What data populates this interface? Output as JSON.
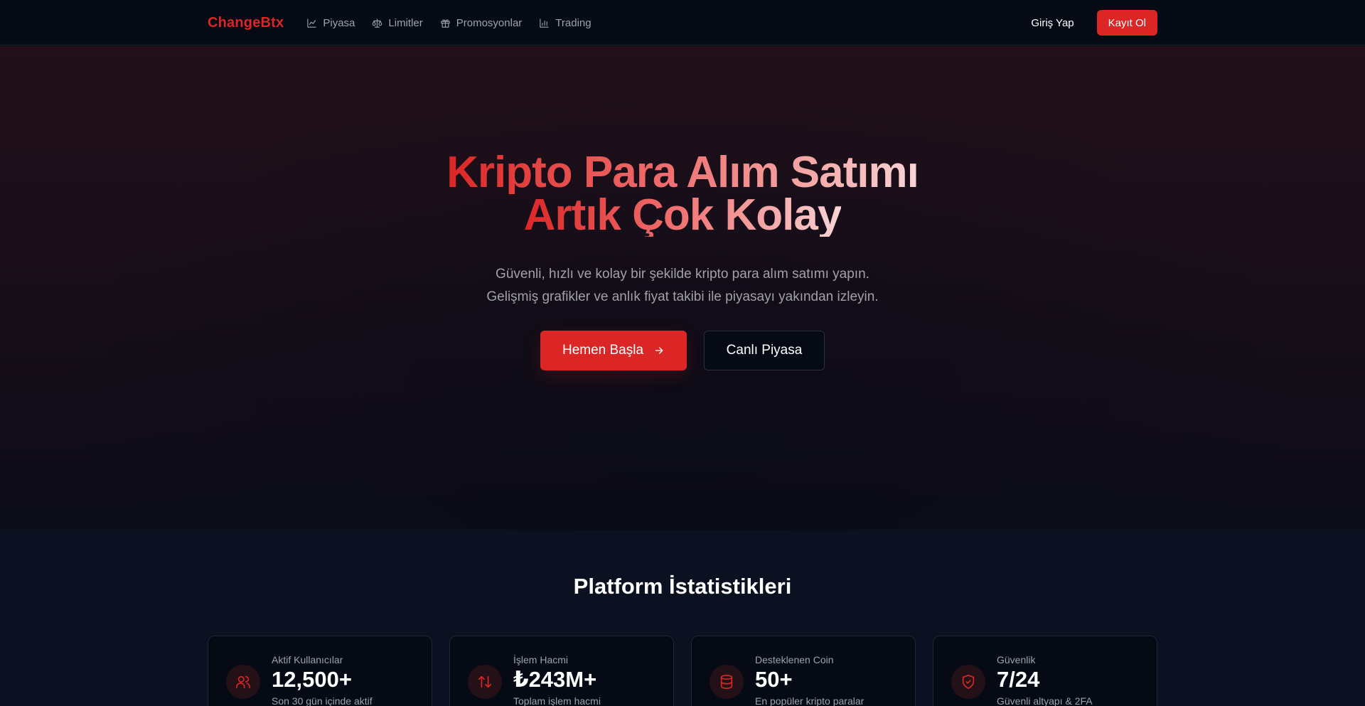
{
  "nav": {
    "brand": "ChangeBtx",
    "links": [
      {
        "label": "Piyasa",
        "icon": "line-chart-icon"
      },
      {
        "label": "Limitler",
        "icon": "scale-icon"
      },
      {
        "label": "Promosyonlar",
        "icon": "gift-icon"
      },
      {
        "label": "Trading",
        "icon": "bar-chart-icon"
      }
    ],
    "login_label": "Giriş Yap",
    "signup_label": "Kayıt Ol"
  },
  "hero": {
    "title_line1": "Kripto Para Alım Satımı",
    "title_line2": "Artık Çok Kolay",
    "subtitle_line1": "Güvenli, hızlı ve kolay bir şekilde kripto para alım satımı yapın.",
    "subtitle_line2": "Gelişmiş grafikler ve anlık fiyat takibi ile piyasayı yakından izleyin.",
    "primary_button": "Hemen Başla",
    "secondary_button": "Canlı Piyasa"
  },
  "stats": {
    "title": "Platform İstatistikleri",
    "cards": [
      {
        "label": "Aktif Kullanıcılar",
        "value": "12,500+",
        "desc": "Son 30 gün içinde aktif",
        "icon": "users-icon"
      },
      {
        "label": "İşlem Hacmi",
        "value": "₺243M+",
        "desc": "Toplam işlem hacmi",
        "icon": "arrows-up-down-icon"
      },
      {
        "label": "Desteklenen Coin",
        "value": "50+",
        "desc": "En popüler kripto paralar",
        "icon": "database-icon"
      },
      {
        "label": "Güvenlik",
        "value": "7/24",
        "desc": "Güvenli altyapı & 2FA",
        "icon": "shield-check-icon"
      }
    ]
  },
  "colors": {
    "accent": "#dc2626",
    "background": "#070b14",
    "muted_text": "#9ca3af"
  }
}
